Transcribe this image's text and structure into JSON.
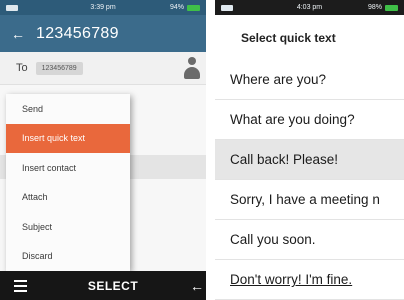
{
  "left_screen": {
    "status": {
      "time": "3:39 pm",
      "battery": "94%"
    },
    "header": {
      "title": "123456789"
    },
    "to_row": {
      "label": "To",
      "recipient": "123456789"
    },
    "options_menu": {
      "items": [
        {
          "label": "Send",
          "selected": false
        },
        {
          "label": "Insert quick text",
          "selected": true
        },
        {
          "label": "Insert contact",
          "selected": false
        },
        {
          "label": "Attach",
          "selected": false
        },
        {
          "label": "Subject",
          "selected": false
        },
        {
          "label": "Discard",
          "selected": false
        }
      ]
    },
    "softkeys": {
      "center": "SELECT",
      "left_icon": "menu-icon",
      "right_icon": "back-arrow-icon"
    }
  },
  "right_screen": {
    "status": {
      "time": "4:03 pm",
      "battery": "98%"
    },
    "title": "Select quick text",
    "items": [
      {
        "label": "Where are you?",
        "selected": false
      },
      {
        "label": "What are you doing?",
        "selected": false
      },
      {
        "label": "Call back! Please!",
        "selected": true
      },
      {
        "label": "Sorry, I have a meeting n",
        "selected": false
      },
      {
        "label": "Call you soon.",
        "selected": false
      },
      {
        "label": "Don't worry! I'm fine.",
        "selected": false
      }
    ]
  },
  "colors": {
    "header": "#3b6b8b",
    "statusbar_left": "#2d5b79",
    "menu_highlight": "#e9683c",
    "softkey_bar": "#161616",
    "list_highlight": "#e6e6e6"
  }
}
